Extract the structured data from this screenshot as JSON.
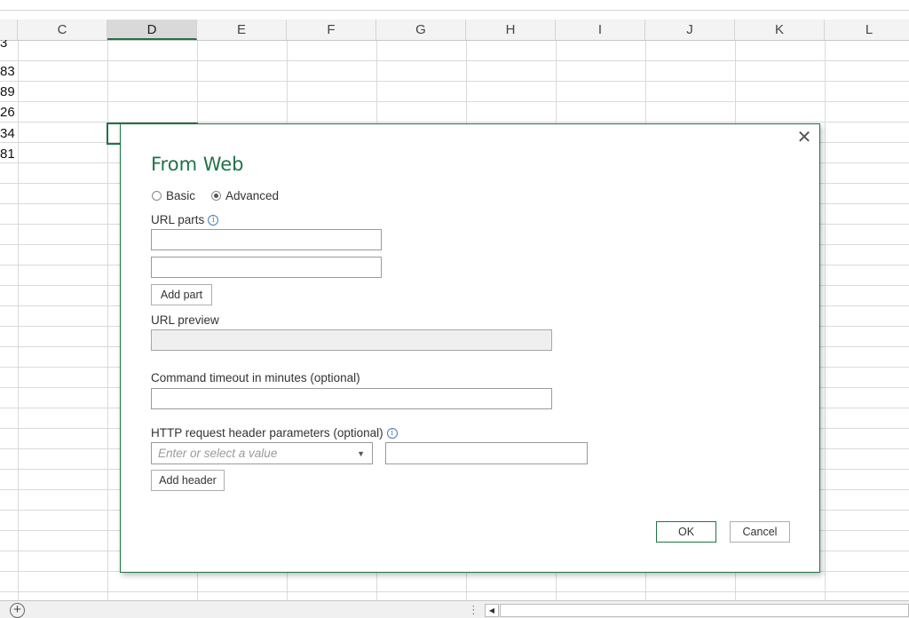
{
  "spreadsheet": {
    "columns": [
      "C",
      "D",
      "E",
      "F",
      "G",
      "H",
      "I",
      "J",
      "K",
      "L"
    ],
    "active_column": "D",
    "partial_values": [
      "3",
      "83",
      "89",
      "26",
      "34",
      "81"
    ],
    "add_sheet_glyph": "+",
    "scroll_left_glyph": "◀",
    "grip_glyph": "⋮"
  },
  "dialog": {
    "title": "From Web",
    "close_glyph": "✕",
    "mode_options": [
      {
        "label": "Basic",
        "selected": false
      },
      {
        "label": "Advanced",
        "selected": true
      }
    ],
    "url_parts_label": "URL parts",
    "info_glyph": "i",
    "url_parts": [
      "",
      ""
    ],
    "add_part_button": "Add part",
    "url_preview_label": "URL preview",
    "url_preview_value": "",
    "timeout_label": "Command timeout in minutes (optional)",
    "timeout_value": "",
    "http_header_label": "HTTP request header parameters (optional)",
    "header_name_placeholder": "Enter or select a value",
    "header_value": "",
    "add_header_button": "Add header",
    "ok_button": "OK",
    "cancel_button": "Cancel"
  },
  "colors": {
    "accent": "#217346",
    "title": "#217346",
    "info_icon": "#4a7fb5",
    "disabled_field": "#efefef"
  },
  "icons": {
    "close": "close-icon",
    "info": "info-icon",
    "dropdown": "chevron-down-icon",
    "add_sheet": "plus-circle-icon"
  }
}
